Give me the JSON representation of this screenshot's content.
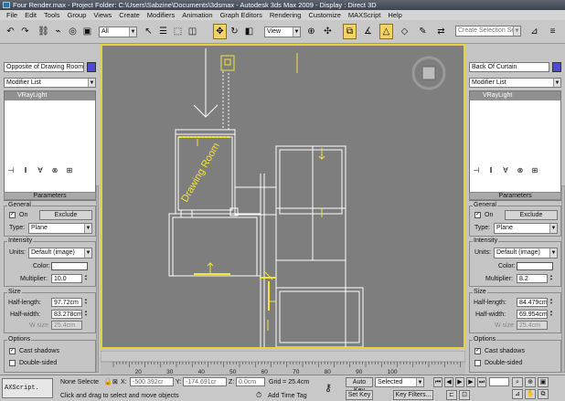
{
  "window": {
    "title": "Four Render.max    - Project Folder: C:\\Users\\Sabzine\\Documents\\3dsmax     - Autodesk 3ds Max  2009      - Display : Direct 3D"
  },
  "menu": [
    "File",
    "Edit",
    "Tools",
    "Group",
    "Views",
    "Create",
    "Modifiers",
    "Animation",
    "Graph Editors",
    "Rendering",
    "Customize",
    "MAXScript",
    "Help"
  ],
  "toolbar": {
    "selection_filter": "All",
    "reference_coord": "View",
    "named_selection_placeholder": "Create Selection Set"
  },
  "left_panel": {
    "object_name": "Opposite of Drawing Room",
    "modifier_list": "Modifier List",
    "stack_item": "VRayLight",
    "rollout_title": "Parameters",
    "general": {
      "title": "General",
      "on_label": "On",
      "on_checked": true,
      "exclude_label": "Exclude",
      "type_label": "Type:",
      "type_value": "Plane"
    },
    "intensity": {
      "title": "Intensity",
      "units_label": "Units:",
      "units_value": "Default (image)",
      "color_label": "Color:",
      "multiplier_label": "Multiplier:",
      "multiplier_value": "10.0"
    },
    "size": {
      "title": "Size",
      "half_length_label": "Half-length:",
      "half_length_value": "97.72cm",
      "half_width_label": "Half-width:",
      "half_width_value": "83.278cm",
      "w_size_label": "W size",
      "w_size_value": "25.4cm"
    },
    "options": {
      "title": "Options",
      "cast_shadows_label": "Cast shadows",
      "cast_shadows_checked": true,
      "double_sided_label": "Double-sided",
      "double_sided_checked": false
    }
  },
  "right_panel": {
    "object_name": "Back Of Curtain",
    "modifier_list": "Modifier List",
    "stack_item": "VRayLight",
    "rollout_title": "Parameters",
    "general": {
      "title": "General",
      "on_label": "On",
      "on_checked": true,
      "exclude_label": "Exclude",
      "type_label": "Type:",
      "type_value": "Plane"
    },
    "intensity": {
      "title": "Intensity",
      "units_label": "Units:",
      "units_value": "Default (image)",
      "color_label": "Color:",
      "multiplier_label": "Multiplier:",
      "multiplier_value": "8.2"
    },
    "size": {
      "title": "Size",
      "half_length_label": "Half-length:",
      "half_length_value": "84.479cm",
      "half_width_label": "Half-width:",
      "half_width_value": "69.954cm",
      "w_size_label": "W size",
      "w_size_value": "25.4cm"
    },
    "options": {
      "title": "Options",
      "cast_shadows_label": "Cast shadows",
      "cast_shadows_checked": true,
      "double_sided_label": "Double-sided",
      "double_sided_checked": false
    }
  },
  "viewport": {
    "room_label": "Drawing Room",
    "background": "#7e7e7e",
    "border_color": "#e6d23a",
    "wire_color": "#ffffff",
    "light_color": "#f2e33a"
  },
  "timeline": {
    "ticks": [
      "20",
      "30",
      "40",
      "50",
      "60",
      "70",
      "80",
      "90",
      "100"
    ]
  },
  "statusbar": {
    "maxscript_label": "AXScript.",
    "selection_status": "None Selecte",
    "x_label": "X:",
    "x_value": "-500.392cr",
    "y_label": "Y:",
    "y_value": "-174.691cr",
    "z_label": "Z:",
    "z_value": "0.0cm",
    "grid": "Grid = 25.4cm",
    "prompt": "Click and drag to select and move objects",
    "add_time_tag": "Add Time Tag",
    "auto_key": "Auto Key",
    "auto_key_value": "Selected",
    "set_key": "Set Key",
    "key_filters": "Key Filters..."
  }
}
